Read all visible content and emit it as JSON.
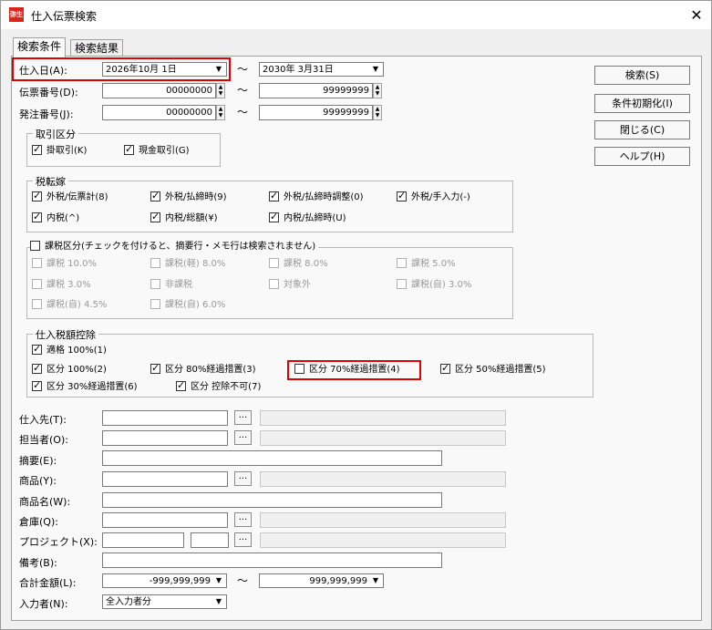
{
  "window": {
    "title": "仕入伝票検索",
    "app_icon_text": "弥生",
    "close_glyph": "✕"
  },
  "tabs": [
    {
      "label": "検索条件"
    },
    {
      "label": "検索結果"
    }
  ],
  "tilde": "～",
  "date": {
    "label": "仕入日(A):",
    "from": "2026年10月 1日",
    "to": "2030年 3月31日"
  },
  "slip_no": {
    "label": "伝票番号(D):",
    "from": "00000000",
    "to": "99999999"
  },
  "order_no": {
    "label": "発注番号(J):",
    "from": "00000000",
    "to": "99999999"
  },
  "buttons": {
    "search": "検索(S)",
    "reset": "条件初期化(I)",
    "close": "閉じる(C)",
    "help": "ヘルプ(H)",
    "browse": "..."
  },
  "trade": {
    "legend": "取引区分",
    "credit": "掛取引(K)",
    "cash": "現金取引(G)"
  },
  "tax_transfer": {
    "legend": "税転嫁",
    "items": [
      "外税/伝票計(8)",
      "外税/払締時(9)",
      "外税/払締時調整(0)",
      "外税/手入力(-)",
      "内税(^)",
      "内税/総額(¥)",
      "内税/払締時(U)"
    ]
  },
  "tax_class": {
    "legend": "課税区分(チェックを付けると、摘要行・メモ行は検索されません)",
    "items": [
      "課税 10.0%",
      "課税(軽) 8.0%",
      "課税 8.0%",
      "課税 5.0%",
      "課税 3.0%",
      "非課税",
      "対象外",
      "課税(自) 3.0%",
      "課税(自) 4.5%",
      "課税(自) 6.0%"
    ]
  },
  "deduction": {
    "legend": "仕入税額控除",
    "items": [
      "適格 100%(1)",
      "区分 100%(2)",
      "区分 80%経過措置(3)",
      "区分 70%経過措置(4)",
      "区分 50%経過措置(5)",
      "区分 30%経過措置(6)",
      "区分 控除不可(7)"
    ]
  },
  "fields": {
    "supplier": "仕入先(T):",
    "staff": "担当者(O):",
    "summary": "摘要(E):",
    "product": "商品(Y):",
    "product_name": "商品名(W):",
    "warehouse": "倉庫(Q):",
    "project": "プロジェクト(X):",
    "note": "備考(B):",
    "total": "合計金額(L):",
    "entered_by": "入力者(N):"
  },
  "total": {
    "from": "-999,999,999",
    "to": "999,999,999"
  },
  "entered_by_value": "全入力者分",
  "colors": {
    "highlight": "#e00000",
    "app_icon": "#d9241b"
  }
}
